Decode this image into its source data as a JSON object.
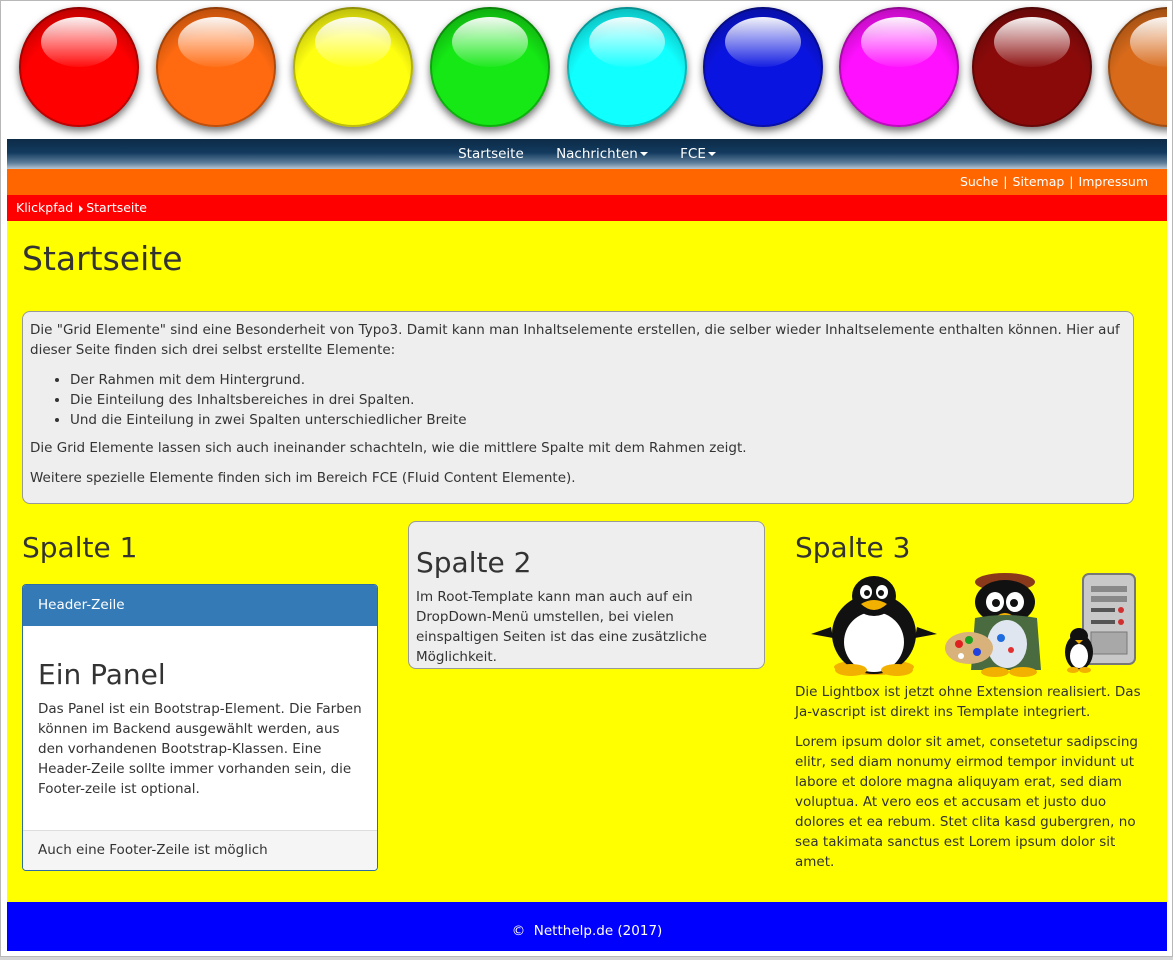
{
  "colors": {
    "balls": [
      "#ff0000",
      "#ff6a10",
      "#ffff10",
      "#15e815",
      "#10ffff",
      "#0a14e0",
      "#ff10ff",
      "#8a0a0a",
      "#d86a1a"
    ],
    "nav": "#0d2b47",
    "orange_bar": "#ff6600",
    "breadcrumb_bar": "#ff0000",
    "content_bg": "#ffff00",
    "footer_bg": "#0000ff",
    "panel_header": "#337ab7"
  },
  "nav": {
    "items": [
      {
        "label": "Startseite"
      },
      {
        "label": "Nachrichten",
        "icon": "caret-down-icon"
      },
      {
        "label": "FCE",
        "icon": "caret-down-icon"
      }
    ]
  },
  "toplinks": [
    "Suche",
    "Sitemap",
    "Impressum"
  ],
  "breadcrumb": {
    "label": "Klickpfad",
    "current": "Startseite"
  },
  "page_title": "Startseite",
  "intro": {
    "p1": "Die \"Grid Elemente\" sind eine Besonderheit von Typo3. Damit kann man Inhaltselemente erstellen, die selber wieder Inhaltselemente enthalten können. Hier auf dieser Seite finden sich drei selbst erstellte Elemente:",
    "list": [
      "Der Rahmen mit dem Hintergrund.",
      "Die Einteilung des Inhaltsbereiches in drei Spalten.",
      "Und die Einteilung in zwei Spalten unterschiedlicher Breite"
    ],
    "p2": "Die Grid Elemente lassen sich auch ineinander schachteln, wie die mittlere Spalte mit dem Rahmen zeigt.",
    "p3": "Weitere spezielle Elemente finden sich im Bereich FCE (Fluid Content Elemente)."
  },
  "col1": {
    "title": "Spalte 1",
    "panel": {
      "header": "Header-Zeile",
      "title": "Ein Panel",
      "text": "Das Panel ist ein Bootstrap-Element. Die Farben können im Backend ausgewählt werden, aus den vorhandenen Bootstrap-Klassen. Eine Header-Zeile sollte immer vorhanden sein, die Footer-zeile ist optional.",
      "footer": "Auch eine Footer-Zeile ist möglich"
    }
  },
  "col2": {
    "title": "Spalte 2",
    "text": "Im Root-Template kann man auch auf ein DropDown-Menü umstellen, bei vielen einspaltigen Seiten ist das eine zusätzliche Möglichkeit."
  },
  "col3": {
    "title": "Spalte 3",
    "images": [
      "tux-penguin-image",
      "painter-penguin-image",
      "server-penguin-image"
    ],
    "p1": "Die Lightbox ist jetzt ohne Extension realisiert. Das Ja-vascript ist direkt ins Template integriert.",
    "p2": "Lorem ipsum dolor sit amet, consetetur sadipscing elitr, sed diam nonumy eirmod tempor invidunt ut labore et dolore magna aliquyam erat, sed diam voluptua. At vero eos et accusam et justo duo dolores et ea rebum. Stet clita kasd gubergren, no sea takimata sanctus est Lorem ipsum dolor sit amet."
  },
  "footer": {
    "symbol": "©",
    "text": "Netthelp.de (2017)"
  }
}
